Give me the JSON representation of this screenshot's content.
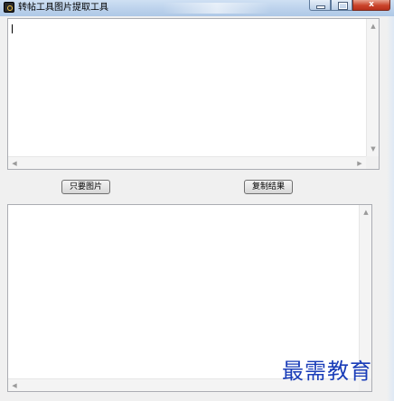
{
  "window": {
    "title": "转帖工具图片提取工具",
    "close_glyph": "x",
    "accent": "#c9432a"
  },
  "input_area": {
    "value": ""
  },
  "buttons": {
    "only_images": "只要图片",
    "copy_result": "复制结果"
  },
  "output_area": {
    "value": ""
  },
  "watermark": {
    "text": "最需教育"
  },
  "icons": {
    "app": "app-icon",
    "minimize": "minimize-icon",
    "maximize": "maximize-icon",
    "close": "close-icon"
  }
}
